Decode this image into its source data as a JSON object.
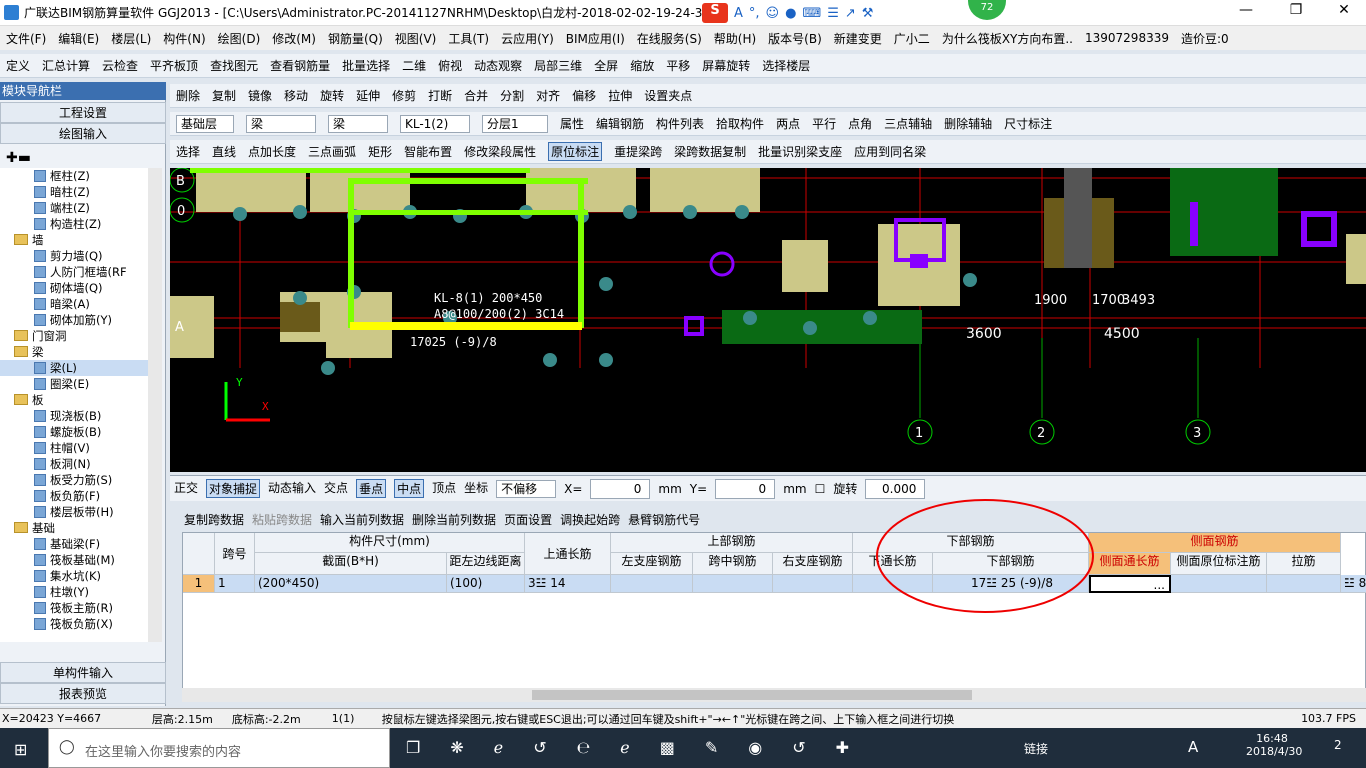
{
  "window": {
    "title": "广联达BIM钢筋算量软件 GGJ2013 - [C:\\Users\\Administrator.PC-20141127NRHM\\Desktop\\白龙村-2018-02-02-19-24-35",
    "badge": "72",
    "ime": [
      "S",
      "A",
      "°,",
      "☺",
      "●",
      "⌨",
      "☰",
      "↗",
      "⚒"
    ]
  },
  "menu": [
    "文件(F)",
    "编辑(E)",
    "楼层(L)",
    "构件(N)",
    "绘图(D)",
    "修改(M)",
    "钢筋量(Q)",
    "视图(V)",
    "工具(T)",
    "云应用(Y)",
    "BIM应用(I)",
    "在线服务(S)",
    "帮助(H)",
    "版本号(B)",
    "新建变更",
    "广小二",
    "为什么筏板XY方向布置..",
    "13907298339",
    "造价豆:0"
  ],
  "toolbar1": [
    "定义",
    "汇总计算",
    "云检查",
    "平齐板顶",
    "查找图元",
    "查看钢筋量",
    "批量选择",
    "二维",
    "俯视",
    "动态观察",
    "局部三维",
    "全屏",
    "缩放",
    "平移",
    "屏幕旋转",
    "选择楼层"
  ],
  "toolbar2": [
    "删除",
    "复制",
    "镜像",
    "移动",
    "旋转",
    "延伸",
    "修剪",
    "打断",
    "合并",
    "分割",
    "对齐",
    "偏移",
    "拉伸",
    "设置夹点"
  ],
  "toolbar3": {
    "floor": "基础层",
    "type1": "梁",
    "type2": "梁",
    "comp": "KL-1(2)",
    "layer": "分层1",
    "items": [
      "属性",
      "编辑钢筋",
      "构件列表",
      "拾取构件",
      "两点",
      "平行",
      "点角",
      "三点辅轴",
      "删除辅轴",
      "尺寸标注"
    ]
  },
  "toolbar4": [
    "选择",
    "直线",
    "点加长度",
    "三点画弧",
    "矩形",
    "智能布置",
    "修改梁段属性",
    "原位标注",
    "重提梁跨",
    "梁跨数据复制",
    "批量识别梁支座",
    "应用到同名梁"
  ],
  "sidebar": {
    "title": "模块导航栏",
    "btn1": "工程设置",
    "btn2": "绘图输入",
    "tree": [
      {
        "t": "框柱(Z)",
        "l": 3
      },
      {
        "t": "暗柱(Z)",
        "l": 3
      },
      {
        "t": "端柱(Z)",
        "l": 3
      },
      {
        "t": "构造柱(Z)",
        "l": 3
      },
      {
        "t": "墙",
        "l": 1,
        "f": 1
      },
      {
        "t": "剪力墙(Q)",
        "l": 3
      },
      {
        "t": "人防门框墙(RF",
        "l": 3
      },
      {
        "t": "砌体墙(Q)",
        "l": 3
      },
      {
        "t": "暗梁(A)",
        "l": 3
      },
      {
        "t": "砌体加筋(Y)",
        "l": 3
      },
      {
        "t": "门窗洞",
        "l": 1,
        "f": 1
      },
      {
        "t": "梁",
        "l": 1,
        "f": 1
      },
      {
        "t": "梁(L)",
        "l": 3
      },
      {
        "t": "圈梁(E)",
        "l": 3
      },
      {
        "t": "板",
        "l": 1,
        "f": 1
      },
      {
        "t": "现浇板(B)",
        "l": 3
      },
      {
        "t": "螺旋板(B)",
        "l": 3
      },
      {
        "t": "柱帽(V)",
        "l": 3
      },
      {
        "t": "板洞(N)",
        "l": 3
      },
      {
        "t": "板受力筋(S)",
        "l": 3
      },
      {
        "t": "板负筋(F)",
        "l": 3
      },
      {
        "t": "楼层板带(H)",
        "l": 3
      },
      {
        "t": "基础",
        "l": 1,
        "f": 1
      },
      {
        "t": "基础梁(F)",
        "l": 3
      },
      {
        "t": "筏板基础(M)",
        "l": 3
      },
      {
        "t": "集水坑(K)",
        "l": 3
      },
      {
        "t": "柱墩(Y)",
        "l": 3
      },
      {
        "t": "筏板主筋(R)",
        "l": 3
      },
      {
        "t": "筏板负筋(X)",
        "l": 3
      }
    ],
    "btn3": "单构件输入",
    "btn4": "报表预览"
  },
  "canvas": {
    "labels": [
      "KL-8(1) 200*450",
      "A8@100/200(2) 3C14",
      "17025 (-9)/8",
      "1900",
      "1700",
      "3493",
      "3600",
      "4500",
      "1",
      "2",
      "3",
      "B",
      "0",
      "A"
    ]
  },
  "snapbar": {
    "items": [
      "正交",
      "对象捕捉",
      "动态输入",
      "交点",
      "垂点",
      "中点",
      "顶点",
      "坐标"
    ],
    "offset": "不偏移",
    "x_label": "X=",
    "x": "0",
    "y_label": "Y=",
    "y": "0",
    "unit": "mm",
    "rotate": "旋转",
    "rotate_val": "0.000"
  },
  "panel_buttons": [
    "复制跨数据",
    "粘贴跨数据",
    "输入当前列数据",
    "删除当前列数据",
    "页面设置",
    "调换起始跨",
    "悬臂钢筋代号"
  ],
  "grid": {
    "h_kuahao": "跨号",
    "h_gjcc": "构件尺寸(mm)",
    "h_jm": "截面(B*H)",
    "h_jl": "距左边线距离",
    "h_stc": "上通长筋",
    "h_sbgj": "上部钢筋",
    "h_zzz": "左支座钢筋",
    "h_kz": "跨中钢筋",
    "h_yzz": "右支座钢筋",
    "h_xbgj": "下部钢筋",
    "h_xtc": "下通长筋",
    "h_xbgj2": "下部钢筋",
    "h_cmgj": "侧面钢筋",
    "h_cmtc": "侧面通长筋",
    "h_cmyw": "侧面原位标注筋",
    "h_lj": "拉筋",
    "row": {
      "n": "1",
      "kuahao": "1",
      "jm": "(200*450)",
      "jl": "(100)",
      "stc": "3☳ 14",
      "xbgj": "17☳ 25 (-9)/8",
      "cmtc": "...",
      "last": "☳ 8"
    }
  },
  "status": {
    "coord": "X=20423 Y=4667",
    "floor_h": "层高:2.15m",
    "bottom_h": "底标高:-2.2m",
    "count": "1(1)",
    "hint": "按鼠标左键选择梁图元,按右键或ESC退出;可以通过回车键及shift+\"→←↑\"光标键在跨之间、上下输入框之间进行切换",
    "fps": "103.7 FPS"
  },
  "taskbar": {
    "search": "在这里输入你要搜索的内容",
    "links": "链接",
    "ime": "A",
    "time": "16:48",
    "date": "2018/4/30",
    "notify": "2"
  }
}
